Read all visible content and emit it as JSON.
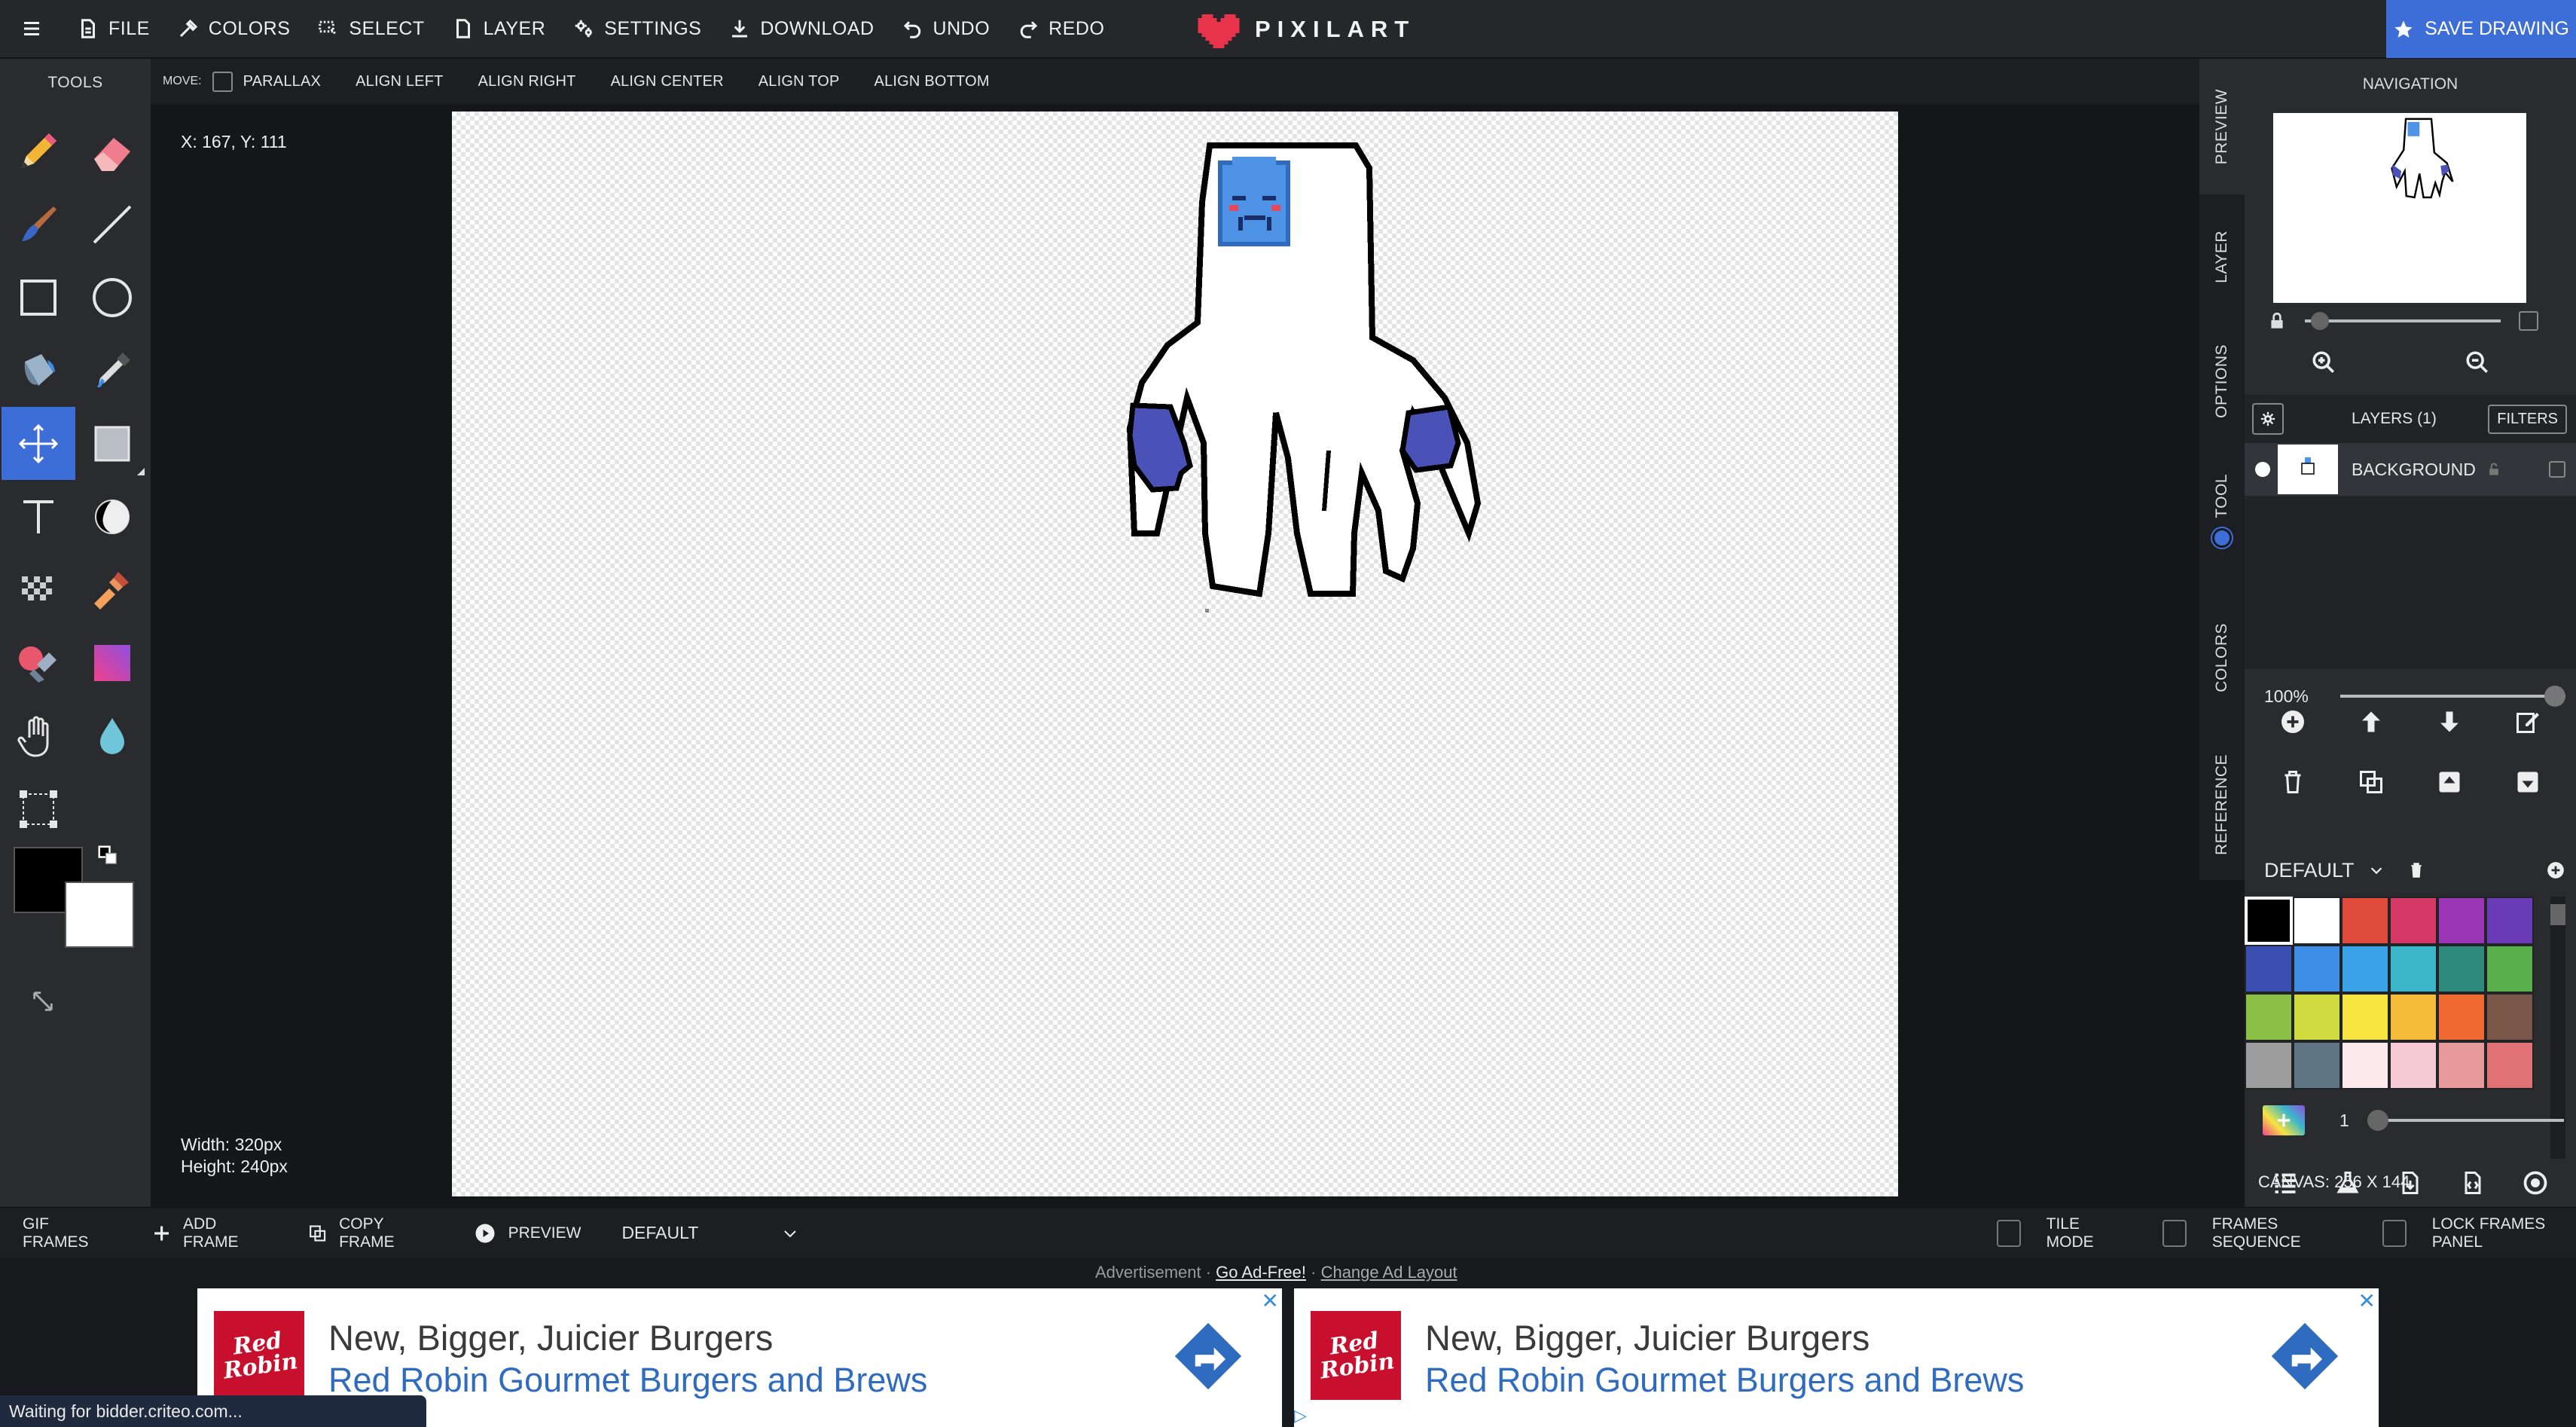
{
  "topbar": {
    "file": "FILE",
    "colors": "COLORS",
    "select": "SELECT",
    "layer": "LAYER",
    "settings": "SETTINGS",
    "download": "DOWNLOAD",
    "undo": "UNDO",
    "redo": "REDO",
    "logo": "PIXILART",
    "save": "SAVE DRAWING"
  },
  "tools": {
    "title": "TOOLS",
    "items": [
      "pencil-icon",
      "eraser-icon",
      "brush-icon",
      "line-icon",
      "rectangle-icon",
      "circle-icon",
      "bucket-icon",
      "eyedropper-icon",
      "move-icon",
      "shape-select-icon",
      "text-icon",
      "shade-icon",
      "dither-icon",
      "stamp-icon",
      "color-replace-icon",
      "gradient-icon",
      "hand-icon",
      "blur-icon",
      "crop-icon"
    ],
    "active": "move-icon",
    "primary_color": "#000000",
    "secondary_color": "#ffffff"
  },
  "options": {
    "label": "MOVE:",
    "parallax": "PARALLAX",
    "align_left": "ALIGN LEFT",
    "align_right": "ALIGN RIGHT",
    "align_center": "ALIGN CENTER",
    "align_top": "ALIGN TOP",
    "align_bottom": "ALIGN BOTTOM"
  },
  "canvas": {
    "coords": "X: 167, Y: 111",
    "width": "Width: 320px",
    "height": "Height: 240px"
  },
  "sidetabs": [
    "PREVIEW",
    "LAYER",
    "OPTIONS",
    "TOOL",
    "COLORS",
    "REFERENCE"
  ],
  "panel": {
    "navigation": "NAVIGATION",
    "layers_title": "LAYERS (1)",
    "filters": "FILTERS",
    "layer_name": "BACKGROUND",
    "opacity": "100%",
    "opacity_value": 100,
    "palette_name": "DEFAULT",
    "brush_size": "1",
    "canvas_size": "CANVAS: 256 X 144"
  },
  "palette": [
    "#000000",
    "#ffffff",
    "#e14b3b",
    "#d63865",
    "#9a35b5",
    "#6a3cb8",
    "#3b4fb3",
    "#3e8ee8",
    "#3aa2e6",
    "#3bb7c9",
    "#2e8a7a",
    "#5aaf4d",
    "#8bbf46",
    "#cfdb3e",
    "#f6e441",
    "#f3bb37",
    "#ef6a31",
    "#7a5548",
    "#9e9e9e",
    "#5f7584",
    "#fbe9ee",
    "#f6cad4",
    "#e89a9a",
    "#e07275"
  ],
  "frames": {
    "gif_frames": "GIF FRAMES",
    "add_frame": "ADD FRAME",
    "copy_frame": "COPY FRAME",
    "preview": "PREVIEW",
    "default": "DEFAULT",
    "tile_mode": "TILE MODE",
    "frames_sequence": "FRAMES SEQUENCE",
    "lock_frames_panel": "LOCK FRAMES PANEL"
  },
  "ads": {
    "advertisement": "Advertisement · ",
    "go_ad_free": "Go Ad-Free!",
    "sep": " · ",
    "change_layout": "Change Ad Layout",
    "headline": "New, Bigger, Juicier Burgers",
    "subline": "Red Robin Gourmet Burgers and Brews",
    "logo_text": "Red Robin"
  },
  "status": "Waiting for bidder.criteo.com..."
}
